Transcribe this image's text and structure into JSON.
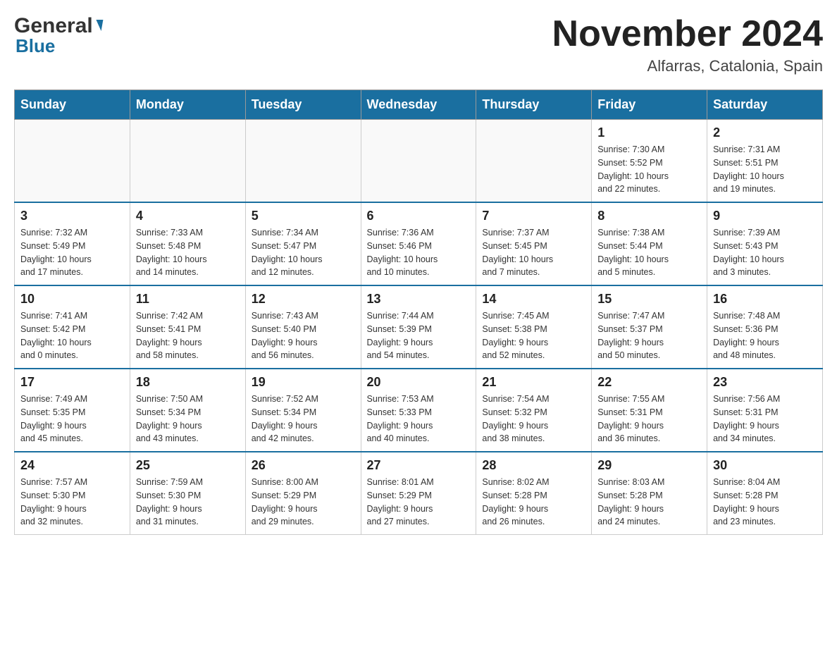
{
  "header": {
    "logo_text1": "General",
    "logo_text2": "Blue",
    "month_title": "November 2024",
    "location": "Alfarras, Catalonia, Spain"
  },
  "weekdays": [
    "Sunday",
    "Monday",
    "Tuesday",
    "Wednesday",
    "Thursday",
    "Friday",
    "Saturday"
  ],
  "weeks": [
    [
      {
        "day": "",
        "info": ""
      },
      {
        "day": "",
        "info": ""
      },
      {
        "day": "",
        "info": ""
      },
      {
        "day": "",
        "info": ""
      },
      {
        "day": "",
        "info": ""
      },
      {
        "day": "1",
        "info": "Sunrise: 7:30 AM\nSunset: 5:52 PM\nDaylight: 10 hours\nand 22 minutes."
      },
      {
        "day": "2",
        "info": "Sunrise: 7:31 AM\nSunset: 5:51 PM\nDaylight: 10 hours\nand 19 minutes."
      }
    ],
    [
      {
        "day": "3",
        "info": "Sunrise: 7:32 AM\nSunset: 5:49 PM\nDaylight: 10 hours\nand 17 minutes."
      },
      {
        "day": "4",
        "info": "Sunrise: 7:33 AM\nSunset: 5:48 PM\nDaylight: 10 hours\nand 14 minutes."
      },
      {
        "day": "5",
        "info": "Sunrise: 7:34 AM\nSunset: 5:47 PM\nDaylight: 10 hours\nand 12 minutes."
      },
      {
        "day": "6",
        "info": "Sunrise: 7:36 AM\nSunset: 5:46 PM\nDaylight: 10 hours\nand 10 minutes."
      },
      {
        "day": "7",
        "info": "Sunrise: 7:37 AM\nSunset: 5:45 PM\nDaylight: 10 hours\nand 7 minutes."
      },
      {
        "day": "8",
        "info": "Sunrise: 7:38 AM\nSunset: 5:44 PM\nDaylight: 10 hours\nand 5 minutes."
      },
      {
        "day": "9",
        "info": "Sunrise: 7:39 AM\nSunset: 5:43 PM\nDaylight: 10 hours\nand 3 minutes."
      }
    ],
    [
      {
        "day": "10",
        "info": "Sunrise: 7:41 AM\nSunset: 5:42 PM\nDaylight: 10 hours\nand 0 minutes."
      },
      {
        "day": "11",
        "info": "Sunrise: 7:42 AM\nSunset: 5:41 PM\nDaylight: 9 hours\nand 58 minutes."
      },
      {
        "day": "12",
        "info": "Sunrise: 7:43 AM\nSunset: 5:40 PM\nDaylight: 9 hours\nand 56 minutes."
      },
      {
        "day": "13",
        "info": "Sunrise: 7:44 AM\nSunset: 5:39 PM\nDaylight: 9 hours\nand 54 minutes."
      },
      {
        "day": "14",
        "info": "Sunrise: 7:45 AM\nSunset: 5:38 PM\nDaylight: 9 hours\nand 52 minutes."
      },
      {
        "day": "15",
        "info": "Sunrise: 7:47 AM\nSunset: 5:37 PM\nDaylight: 9 hours\nand 50 minutes."
      },
      {
        "day": "16",
        "info": "Sunrise: 7:48 AM\nSunset: 5:36 PM\nDaylight: 9 hours\nand 48 minutes."
      }
    ],
    [
      {
        "day": "17",
        "info": "Sunrise: 7:49 AM\nSunset: 5:35 PM\nDaylight: 9 hours\nand 45 minutes."
      },
      {
        "day": "18",
        "info": "Sunrise: 7:50 AM\nSunset: 5:34 PM\nDaylight: 9 hours\nand 43 minutes."
      },
      {
        "day": "19",
        "info": "Sunrise: 7:52 AM\nSunset: 5:34 PM\nDaylight: 9 hours\nand 42 minutes."
      },
      {
        "day": "20",
        "info": "Sunrise: 7:53 AM\nSunset: 5:33 PM\nDaylight: 9 hours\nand 40 minutes."
      },
      {
        "day": "21",
        "info": "Sunrise: 7:54 AM\nSunset: 5:32 PM\nDaylight: 9 hours\nand 38 minutes."
      },
      {
        "day": "22",
        "info": "Sunrise: 7:55 AM\nSunset: 5:31 PM\nDaylight: 9 hours\nand 36 minutes."
      },
      {
        "day": "23",
        "info": "Sunrise: 7:56 AM\nSunset: 5:31 PM\nDaylight: 9 hours\nand 34 minutes."
      }
    ],
    [
      {
        "day": "24",
        "info": "Sunrise: 7:57 AM\nSunset: 5:30 PM\nDaylight: 9 hours\nand 32 minutes."
      },
      {
        "day": "25",
        "info": "Sunrise: 7:59 AM\nSunset: 5:30 PM\nDaylight: 9 hours\nand 31 minutes."
      },
      {
        "day": "26",
        "info": "Sunrise: 8:00 AM\nSunset: 5:29 PM\nDaylight: 9 hours\nand 29 minutes."
      },
      {
        "day": "27",
        "info": "Sunrise: 8:01 AM\nSunset: 5:29 PM\nDaylight: 9 hours\nand 27 minutes."
      },
      {
        "day": "28",
        "info": "Sunrise: 8:02 AM\nSunset: 5:28 PM\nDaylight: 9 hours\nand 26 minutes."
      },
      {
        "day": "29",
        "info": "Sunrise: 8:03 AM\nSunset: 5:28 PM\nDaylight: 9 hours\nand 24 minutes."
      },
      {
        "day": "30",
        "info": "Sunrise: 8:04 AM\nSunset: 5:28 PM\nDaylight: 9 hours\nand 23 minutes."
      }
    ]
  ]
}
